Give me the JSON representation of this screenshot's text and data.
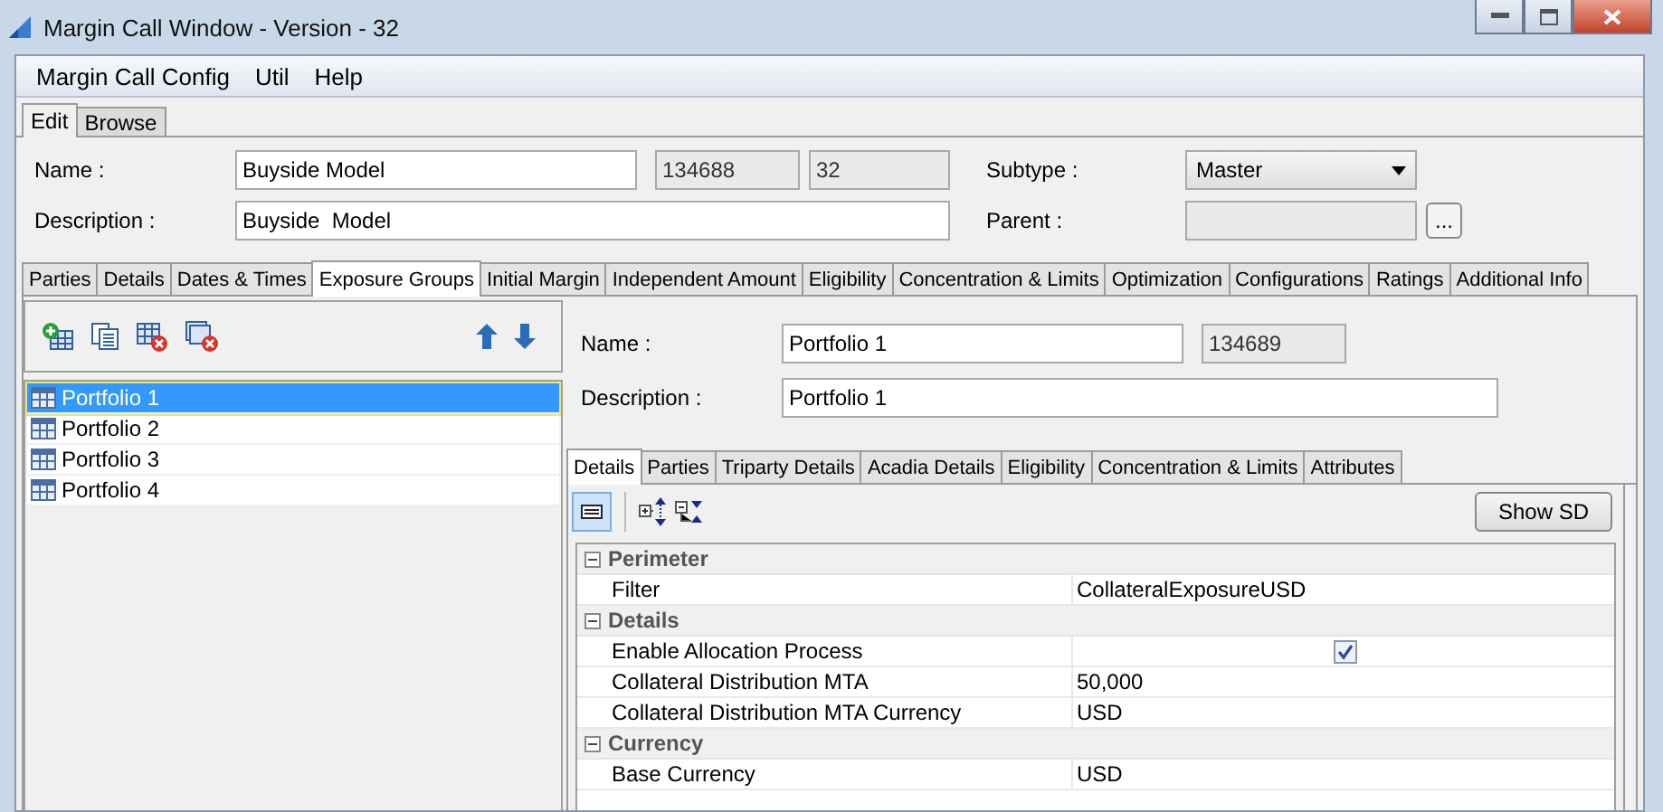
{
  "window": {
    "title": "Margin Call Window - Version - 32"
  },
  "menu": [
    "Margin Call Config",
    "Util",
    "Help"
  ],
  "mode_tabs": [
    {
      "label": "Edit",
      "selected": true
    },
    {
      "label": "Browse",
      "selected": false
    }
  ],
  "header": {
    "name_label": "Name :",
    "name": "Buyside Model",
    "id": "134688",
    "version": "32",
    "subtype_label": "Subtype :",
    "subtype": "Master",
    "description_label": "Description :",
    "description": "Buyside  Model",
    "parent_label": "Parent :",
    "parent_button": "..."
  },
  "tabs": [
    {
      "label": "Parties",
      "selected": false
    },
    {
      "label": "Details",
      "selected": false
    },
    {
      "label": "Dates & Times",
      "selected": false
    },
    {
      "label": "Exposure Groups",
      "selected": true
    },
    {
      "label": "Initial Margin",
      "selected": false
    },
    {
      "label": "Independent Amount",
      "selected": false
    },
    {
      "label": "Eligibility",
      "selected": false
    },
    {
      "label": "Concentration & Limits",
      "selected": false
    },
    {
      "label": "Optimization",
      "selected": false
    },
    {
      "label": "Configurations",
      "selected": false
    },
    {
      "label": "Ratings",
      "selected": false
    },
    {
      "label": "Additional Info",
      "selected": false
    }
  ],
  "portfolios": [
    {
      "label": "Portfolio 1",
      "selected": true
    },
    {
      "label": "Portfolio 2",
      "selected": false
    },
    {
      "label": "Portfolio 3",
      "selected": false
    },
    {
      "label": "Portfolio 4",
      "selected": false
    }
  ],
  "portfolio": {
    "name_label": "Name :",
    "name": "Portfolio 1",
    "id": "134689",
    "description_label": "Description :",
    "description": "Portfolio 1"
  },
  "sub_tabs": [
    {
      "label": "Details",
      "selected": true
    },
    {
      "label": "Parties",
      "selected": false
    },
    {
      "label": "Triparty Details",
      "selected": false
    },
    {
      "label": "Acadia Details",
      "selected": false
    },
    {
      "label": "Eligibility",
      "selected": false
    },
    {
      "label": "Concentration & Limits",
      "selected": false
    },
    {
      "label": "Attributes",
      "selected": false
    }
  ],
  "show_sd_button": "Show SD",
  "properties": [
    {
      "kind": "group",
      "label": "Perimeter"
    },
    {
      "kind": "text",
      "label": "Filter",
      "value": "CollateralExposureUSD"
    },
    {
      "kind": "group",
      "label": "Details"
    },
    {
      "kind": "check",
      "label": "Enable Allocation Process",
      "checked": true
    },
    {
      "kind": "text",
      "label": "Collateral Distribution MTA",
      "value": "50,000"
    },
    {
      "kind": "text",
      "label": "Collateral Distribution MTA Currency",
      "value": "USD"
    },
    {
      "kind": "group",
      "label": "Currency"
    },
    {
      "kind": "text",
      "label": "Base Currency",
      "value": "USD"
    }
  ]
}
